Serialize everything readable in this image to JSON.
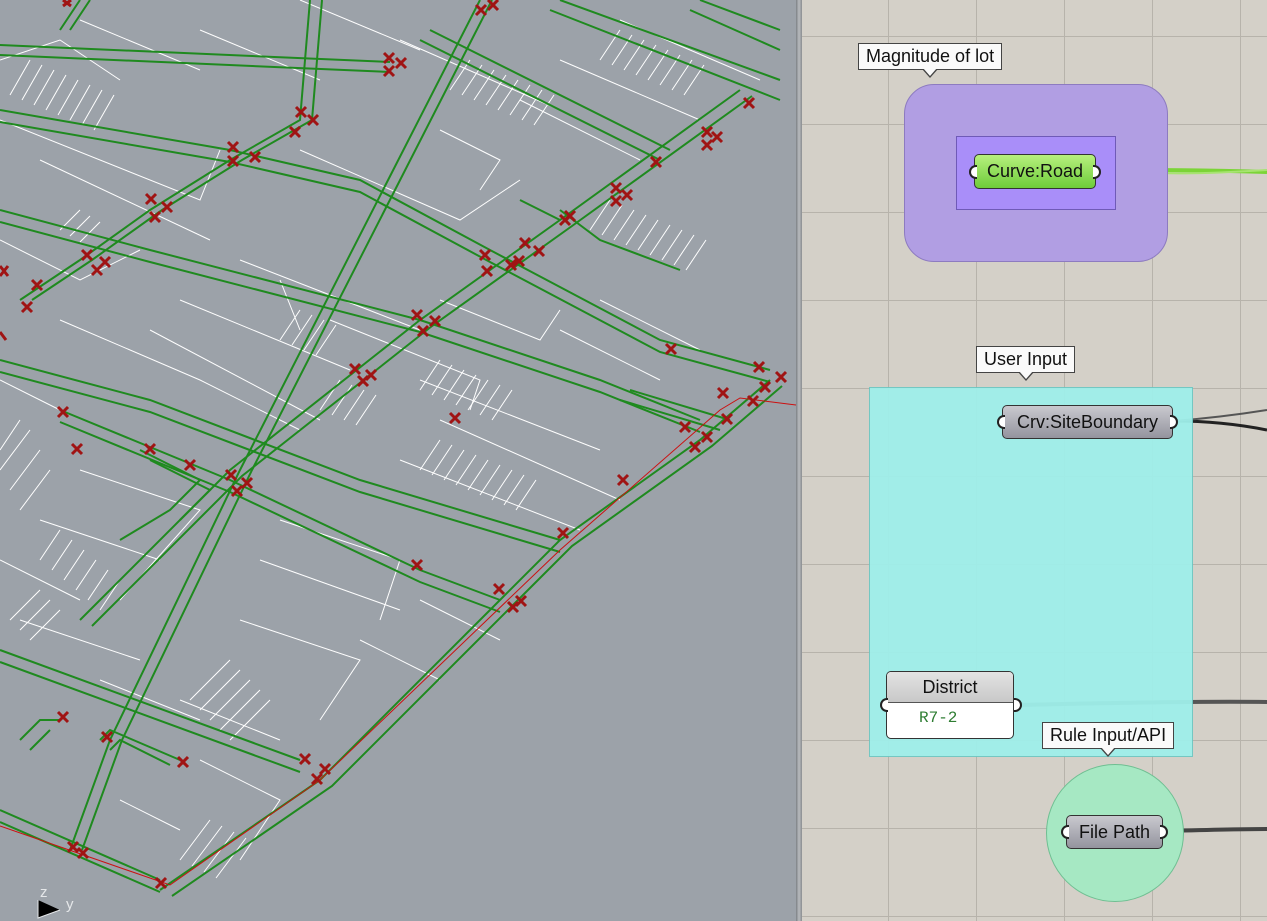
{
  "viewport": {
    "axis_z": "z",
    "axis_y": "y",
    "colors": {
      "background": "#9ca2a9",
      "road": "#1f8a1f",
      "lot": "#ffffff",
      "marker": "#b01818",
      "boundary": "#cc1010"
    }
  },
  "canvas": {
    "colors": {
      "background": "#d4d0c8",
      "grid": "#b7b3ab"
    },
    "groups": {
      "lot": {
        "label": "Magnitude of lot",
        "color": "#b19ee3"
      },
      "user_input": {
        "label": "User Input",
        "color": "#9fefea"
      },
      "rule_input": {
        "label": "Rule Input/API",
        "color": "#a6e8c3"
      }
    },
    "params": {
      "road": "Curve:Road",
      "site_boundary": "Crv:SiteBoundary",
      "file_path": "File Path"
    },
    "district_panel": {
      "title": "District",
      "value": "R7-2"
    }
  }
}
